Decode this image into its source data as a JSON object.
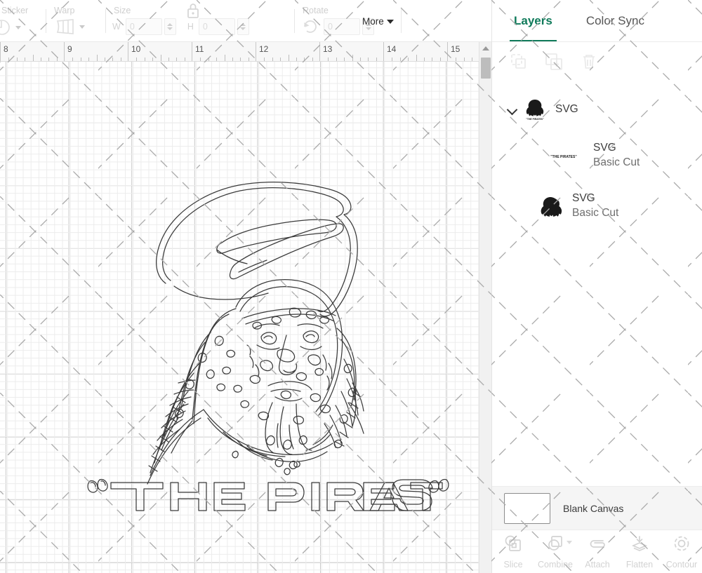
{
  "toolbar": {
    "sticker": {
      "label": "Sticker",
      "icon": "sticker-icon"
    },
    "warp": {
      "label": "Warp",
      "icon": "warp-icon"
    },
    "size": {
      "label": "Size",
      "width_letter": "W",
      "width_value": "0",
      "height_letter": "H",
      "height_value": "0",
      "lock_icon": "lock-icon"
    },
    "rotate": {
      "label": "Rotate",
      "value": "0",
      "icon": "rotate-icon"
    },
    "more": {
      "label": "More"
    }
  },
  "ruler": {
    "marks": [
      "8",
      "9",
      "10",
      "11",
      "12",
      "13",
      "14",
      "15"
    ],
    "start_x": 0,
    "spacing": 91
  },
  "canvas": {
    "artwork_title": "THE PIRATES",
    "scrollbar": {
      "up_arrow": "arrow-up-icon"
    }
  },
  "panel": {
    "tabs": [
      {
        "label": "Layers",
        "active": true
      },
      {
        "label": "Color Sync",
        "active": false
      }
    ],
    "actions": [
      {
        "name": "group-icon"
      },
      {
        "name": "duplicate-icon"
      },
      {
        "name": "delete-icon"
      }
    ],
    "layers": [
      {
        "title": "SVG",
        "sub": "",
        "expanded": true,
        "depth": 0,
        "thumb": "pirate-full"
      },
      {
        "title": "SVG",
        "sub": "Basic Cut",
        "expanded": false,
        "depth": 1,
        "thumb": "pirate-text"
      },
      {
        "title": "SVG",
        "sub": "Basic Cut",
        "expanded": false,
        "depth": 1,
        "thumb": "pirate-head"
      }
    ],
    "canvas_footer": {
      "label": "Blank Canvas",
      "swatch_color": "#ffffff"
    },
    "bottom_tools": [
      {
        "label": "Slice",
        "icon": "slice-icon",
        "has_dropdown": false
      },
      {
        "label": "Combine",
        "icon": "combine-icon",
        "has_dropdown": true
      },
      {
        "label": "Attach",
        "icon": "attach-icon",
        "has_dropdown": false
      },
      {
        "label": "Flatten",
        "icon": "flatten-icon",
        "has_dropdown": false
      },
      {
        "label": "Contour",
        "icon": "contour-icon",
        "has_dropdown": false
      }
    ]
  },
  "colors": {
    "accent": "#0f7a5a",
    "grid_minor": "#ececec",
    "grid_major": "#c9c9c9",
    "hatch": "#a9a9a9",
    "panel_bg": "#ffffff",
    "footer_bg": "#f5f5f5"
  }
}
